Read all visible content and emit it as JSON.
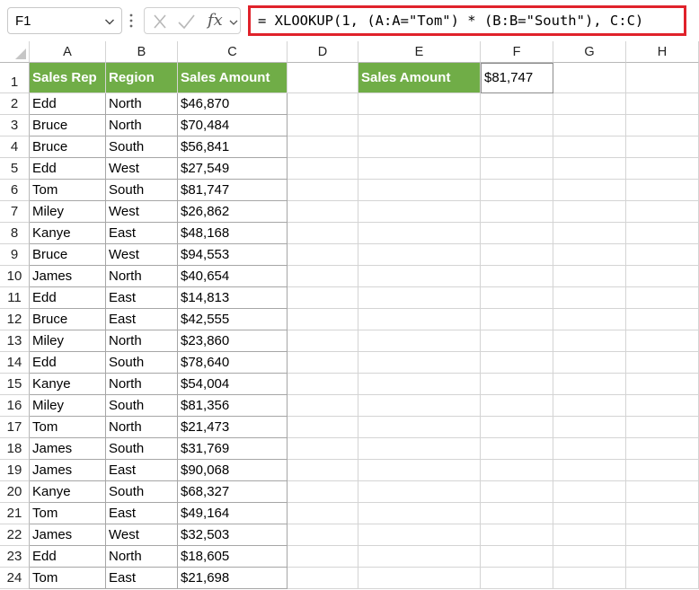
{
  "name_box": {
    "value": "F1"
  },
  "formula_bar": {
    "formula": "= XLOOKUP(1, (A:A=\"Tom\") * (B:B=\"South\"), C:C)",
    "fx_label": "fx"
  },
  "columns": [
    "A",
    "B",
    "C",
    "D",
    "E",
    "F",
    "G",
    "H"
  ],
  "table": {
    "headers": [
      "Sales Rep",
      "Region",
      "Sales Amount"
    ],
    "rows": [
      [
        "Edd",
        "North",
        "$46,870"
      ],
      [
        "Bruce",
        "North",
        "$70,484"
      ],
      [
        "Bruce",
        "South",
        "$56,841"
      ],
      [
        "Edd",
        "West",
        "$27,549"
      ],
      [
        "Tom",
        "South",
        "$81,747"
      ],
      [
        "Miley",
        "West",
        "$26,862"
      ],
      [
        "Kanye",
        "East",
        "$48,168"
      ],
      [
        "Bruce",
        "West",
        "$94,553"
      ],
      [
        "James",
        "North",
        "$40,654"
      ],
      [
        "Edd",
        "East",
        "$14,813"
      ],
      [
        "Bruce",
        "East",
        "$42,555"
      ],
      [
        "Miley",
        "North",
        "$23,860"
      ],
      [
        "Edd",
        "South",
        "$78,640"
      ],
      [
        "Kanye",
        "North",
        "$54,004"
      ],
      [
        "Miley",
        "South",
        "$81,356"
      ],
      [
        "Tom",
        "North",
        "$21,473"
      ],
      [
        "James",
        "South",
        "$31,769"
      ],
      [
        "James",
        "East",
        "$90,068"
      ],
      [
        "Kanye",
        "South",
        "$68,327"
      ],
      [
        "Tom",
        "East",
        "$49,164"
      ],
      [
        "James",
        "West",
        "$32,503"
      ],
      [
        "Edd",
        "North",
        "$18,605"
      ],
      [
        "Tom",
        "East",
        "$21,698"
      ]
    ]
  },
  "result": {
    "label": "Sales Amount",
    "value": "$81,747"
  },
  "colors": {
    "header_fill": "#70ad47",
    "header_text": "#ffffff",
    "formula_highlight": "#e0222b"
  }
}
